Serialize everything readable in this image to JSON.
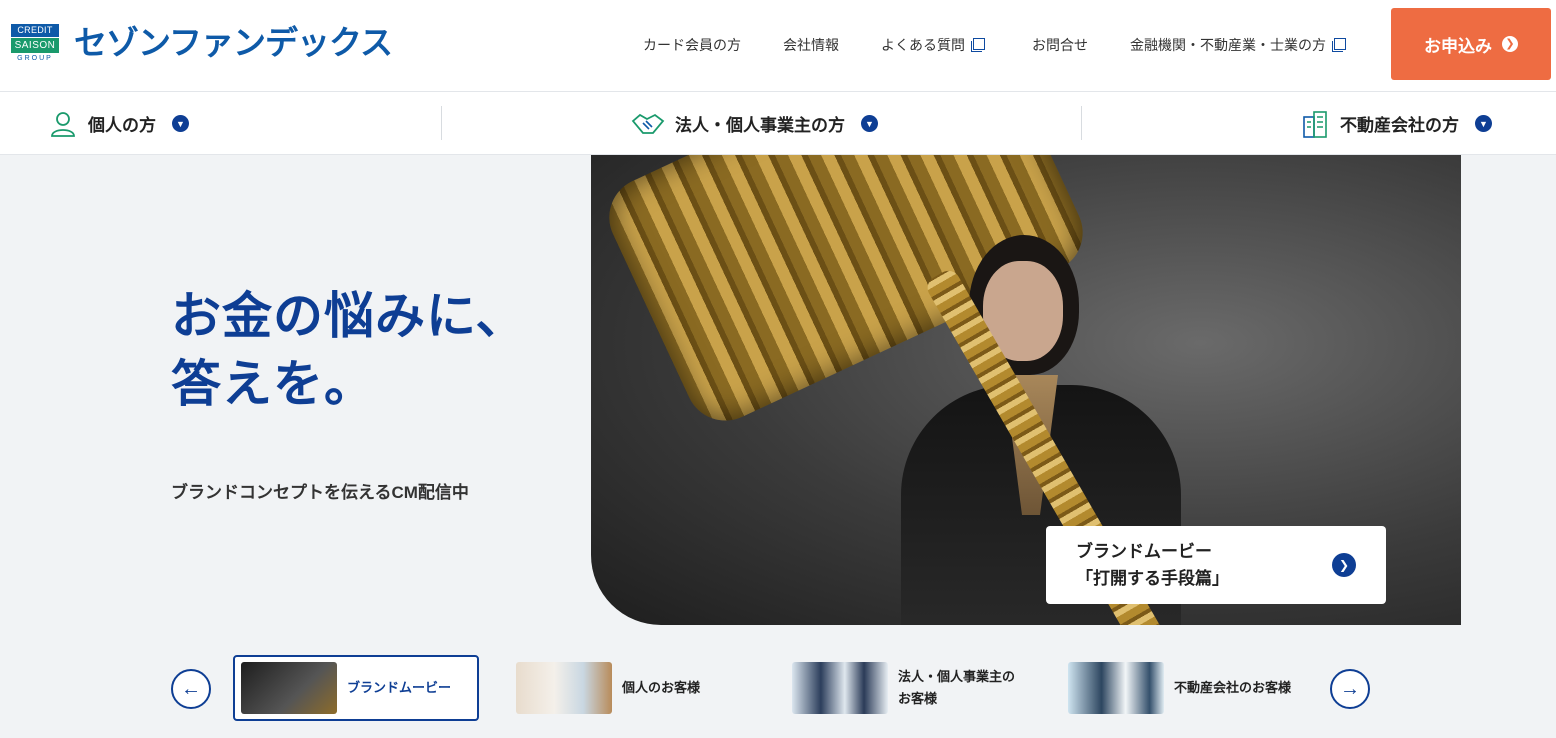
{
  "brand": {
    "logo_line1": "CREDIT",
    "logo_line2": "SAISON",
    "logo_line3": "GROUP",
    "name": "セゾンファンデックス"
  },
  "topnav": {
    "items": [
      {
        "label": "カード会員の方"
      },
      {
        "label": "会社情報"
      },
      {
        "label": "よくある質問"
      },
      {
        "label": "お問合せ"
      },
      {
        "label": "金融機関・不動産業・士業の方"
      }
    ],
    "apply_label": "お申込み"
  },
  "categories": [
    {
      "label": "個人の方",
      "icon": "person-icon"
    },
    {
      "label": "法人・個人事業主の方",
      "icon": "handshake-icon"
    },
    {
      "label": "不動産会社の方",
      "icon": "building-icon"
    }
  ],
  "hero": {
    "title_line1": "お金の悩みに、",
    "title_line2": "答えを。",
    "subtitle": "ブランドコンセプトを伝えるCM配信中",
    "card_line1": "ブランドムービー",
    "card_line2": "「打開する手段篇」"
  },
  "carousel": {
    "items": [
      {
        "label": "ブランドムービー",
        "active": true
      },
      {
        "label": "個人のお客様",
        "active": false
      },
      {
        "label_line1": "法人・個人事業主の",
        "label_line2": "お客様",
        "active": false
      },
      {
        "label": "不動産会社のお客様",
        "active": false
      }
    ]
  },
  "colors": {
    "primary": "#0e3e94",
    "logo_blue": "#0e5aa8",
    "logo_green": "#1a9a6c",
    "accent_orange": "#ee6c42",
    "background": "#f1f3f5"
  }
}
